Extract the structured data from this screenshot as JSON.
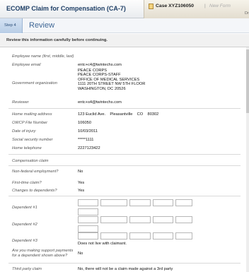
{
  "app": {
    "title": "ECOMP Claim for Compensation (CA-7)"
  },
  "case": {
    "label": "Case XYZ106050",
    "separator": "|",
    "new_form": "New Form",
    "sub": "Dr"
  },
  "step": {
    "tab": "Step 4",
    "title": "Review"
  },
  "notice": "Review this information carefully before continuing.",
  "fields": {
    "employee_name_label": "Employee name (first, middle, last)",
    "employee_email_label": "Employee email",
    "employee_email": "entc+c4@twintechs.com",
    "gov_org_label": "Government organization",
    "gov_org_lines": [
      "PEACE CORPS",
      "PEACE CORPS-STAFF",
      "OFFICE OF MEDICAL SERVICES",
      "1111 20TH STREET NW 5TH FLOOR",
      "WASHINGTON, DC 20526"
    ],
    "reviewer_label": "Reviewer",
    "reviewer": "entc+s4@twintechs.com",
    "home_address_label": "Home mailing address",
    "home_address": "123 Euclid Ave.    Pleasantville    CO    80302",
    "owcp_label": "OWCP File Number",
    "owcp": "106050",
    "doi_label": "Date of injury",
    "doi": "10/03/2011",
    "ssn_label": "Social security number",
    "ssn": "*****1111",
    "phone_label": "Home telephone",
    "phone": "2227123422",
    "comp_claim_label": "Compensation claim",
    "non_federal_label": "Non-federal employment?",
    "non_federal": "No",
    "first_time_label": "First-time claim?",
    "first_time": "Yes",
    "changes_dep_label": "Changes to dependents?",
    "changes_dep": "Yes",
    "dep1_label": "Dependent #1",
    "dep2_label": "Dependent #2",
    "dep3_label": "Dependent #3",
    "dep3_note": "Does not live with claimant.",
    "support_label_1": "Are you making support payments",
    "support_label_2": "for a dependent shown above?",
    "support": "No",
    "third_party_label": "Third party claim",
    "third_party": "No, there will not be a claim made against a 3rd party"
  }
}
